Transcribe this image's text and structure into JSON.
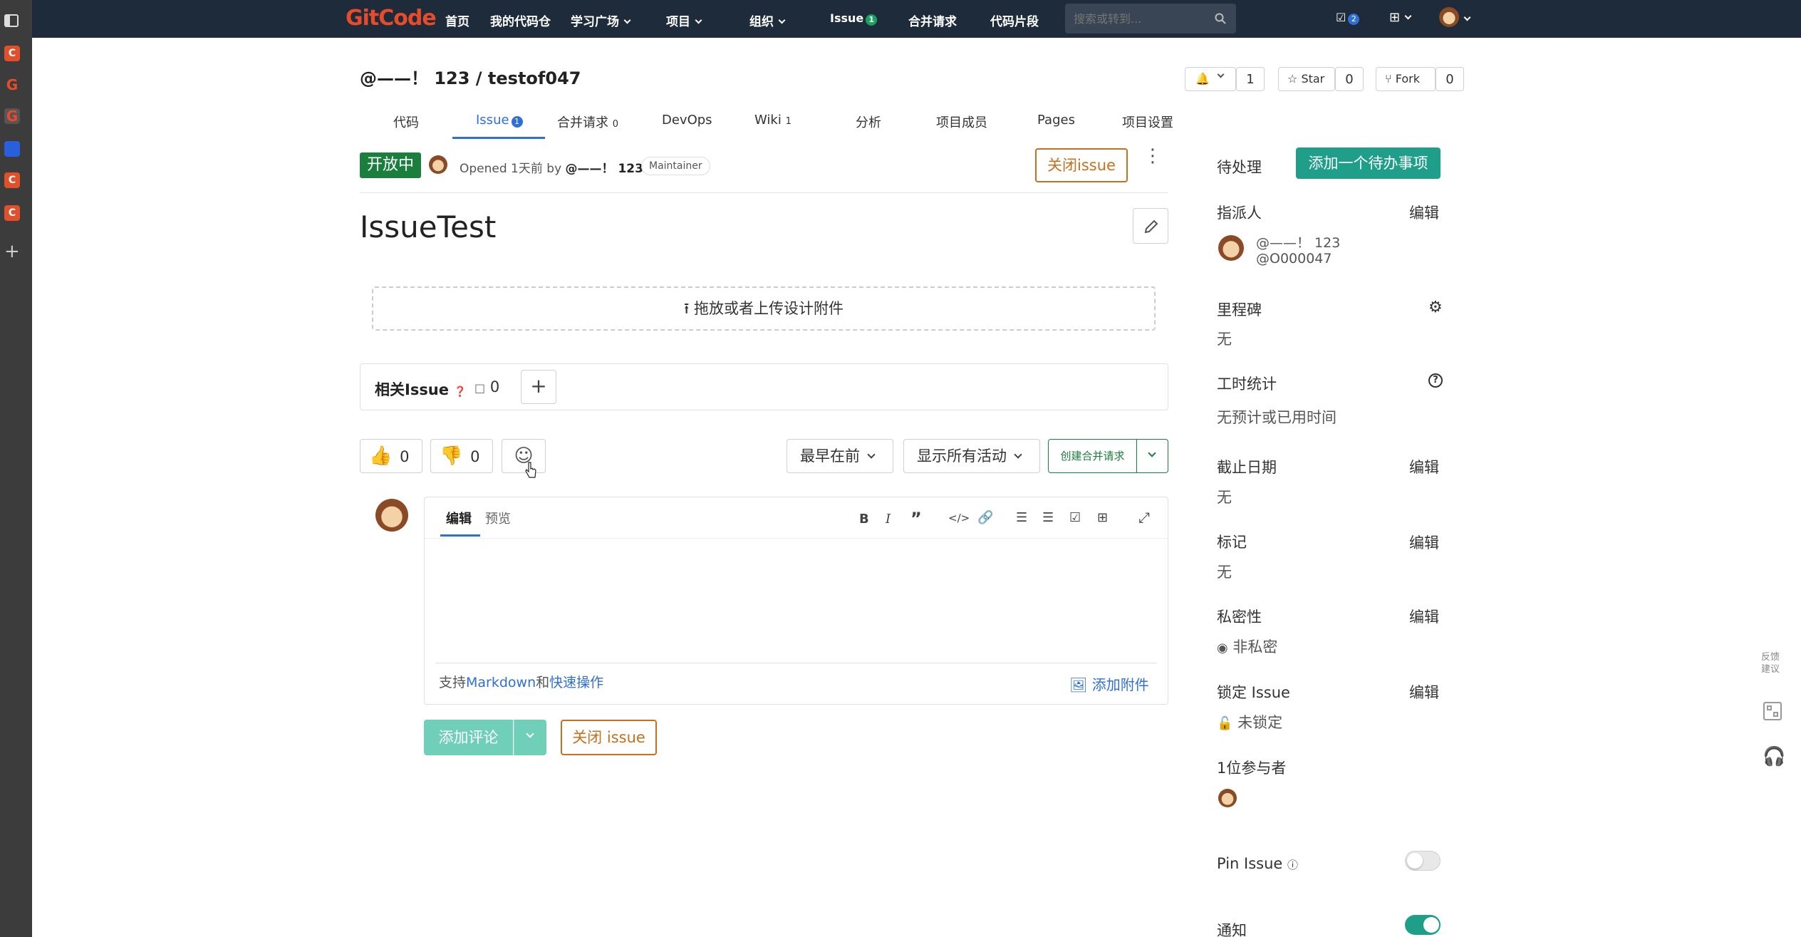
{
  "browser_sidebar": {
    "icons": [
      "sidebar-panel-icon",
      "c-app-icon",
      "g-app-icon",
      "g-app-icon",
      "baidu-icon",
      "c-app-icon",
      "c-app-icon",
      "plus-icon"
    ],
    "c_label": "C",
    "g_label": "G"
  },
  "navbar": {
    "logo_text": "GitCode",
    "items": [
      {
        "label": "首页"
      },
      {
        "label": "我的代码仓"
      },
      {
        "label": "学习广场"
      },
      {
        "label": "项目"
      },
      {
        "label": "组织"
      },
      {
        "label": "Issue",
        "badge": "1"
      },
      {
        "label": "合并请求"
      },
      {
        "label": "代码片段"
      }
    ],
    "search_placeholder": "搜索或转到...",
    "todo_badge": "2"
  },
  "project": {
    "title": "@——！ 123 / testof047",
    "notify_count": "1",
    "star_label": "Star",
    "star_count": "0",
    "fork_label": "Fork",
    "fork_count": "0"
  },
  "tabs": [
    {
      "label": "代码"
    },
    {
      "label": "Issue",
      "badge": "1",
      "active": true
    },
    {
      "label": "合并请求",
      "badge": "0"
    },
    {
      "label": "DevOps"
    },
    {
      "label": "Wiki",
      "badge": "1"
    },
    {
      "label": "分析"
    },
    {
      "label": "项目成员"
    },
    {
      "label": "Pages"
    },
    {
      "label": "项目设置"
    }
  ],
  "issue": {
    "status": "开放中",
    "opened_text": "Opened 1天前 by",
    "author": "@——！ 123",
    "role": "Maintainer",
    "close_button": "关闭issue",
    "title": "IssueTest",
    "upload_text": "拖放或者上传设计附件",
    "related_label": "相关Issue",
    "related_count": "0",
    "thumbs_up": "0",
    "thumbs_down": "0",
    "sort_label": "最早在前",
    "filter_label": "显示所有活动",
    "create_mr": "创建合并请求"
  },
  "editor": {
    "tab_edit": "编辑",
    "tab_preview": "预览",
    "support_prefix": "支持",
    "markdown_link": "Markdown",
    "and_text": "和",
    "shortcuts_link": "快速操作",
    "attach_label": "添加附件",
    "comment_button": "添加评论",
    "close_button": "关闭 issue"
  },
  "sidebar": {
    "todo_label": "待处理",
    "add_todo": "添加一个待办事项",
    "assignee_label": "指派人",
    "edit": "编辑",
    "assignee_name": "@——！ 123",
    "assignee_user": "@O000047",
    "milestone_label": "里程碑",
    "milestone_value": "无",
    "time_label": "工时统计",
    "time_value": "无预计或已用时间",
    "due_label": "截止日期",
    "due_value": "无",
    "labels_label": "标记",
    "labels_value": "无",
    "privacy_label": "私密性",
    "privacy_value": "非私密",
    "lock_label": "锁定 Issue",
    "lock_value": "未锁定",
    "participants_label": "1位参与者",
    "pin_label": "Pin Issue",
    "pin_on": false,
    "notify_label": "通知",
    "notify_on": true
  },
  "float_tools": {
    "feedback": "反馈建议"
  },
  "colors": {
    "nav_bg": "#1e2b3a",
    "brand_red": "#e84b2a",
    "status_green": "#1a7f3c",
    "teal": "#1f9e8a",
    "close_orange": "#c6701c",
    "link_blue": "#2f6fd6"
  }
}
